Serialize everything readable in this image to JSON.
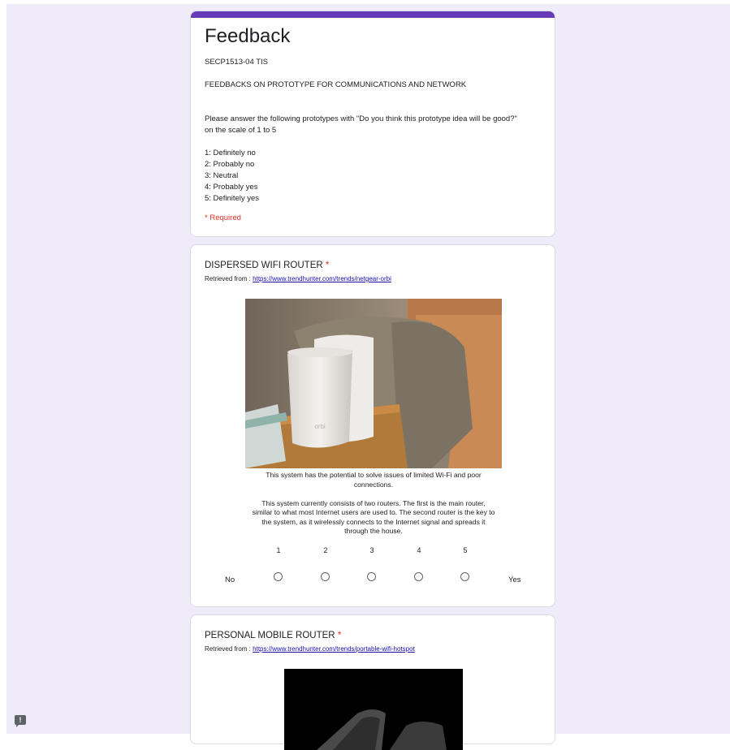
{
  "form": {
    "title": "Feedback",
    "course": "SECP1513-04 TIS",
    "subtitle": "FEEDBACKS ON PROTOTYPE FOR COMMUNICATIONS AND NETWORK",
    "instruction_line1": "Please answer the following prototypes with \"Do you think this prototype idea will be good?\"",
    "instruction_line2": "on the scale of 1 to 5",
    "scale_legend": [
      "1: Definitely no",
      "2: Probably no",
      "3: Neutral",
      "4: Probably yes",
      "5: Definitely yes"
    ],
    "required_note": "* Required",
    "accent_color": "#673ab7",
    "background_color": "#f0ebf8"
  },
  "questions": [
    {
      "title": "DISPERSED WIFI ROUTER",
      "star": "*",
      "retrieved_prefix": "Retrieved from : ",
      "retrieved_link": "https://www.trendhunter.com/trends/netgear-orbi",
      "caption_lines": [
        "This system has the potential to solve issues of limited Wi-Fi and poor",
        "connections.",
        "",
        "This system currently consists of two routers. The first is the main router,",
        "similar to what most Internet users are used to. The second router is the key to",
        "the system, as it wirelessly connects to the Internet signal and spreads it",
        "through the house."
      ],
      "scale": [
        "1",
        "2",
        "3",
        "4",
        "5"
      ],
      "low_label": "No",
      "high_label": "Yes",
      "photo_brand": "orbi"
    },
    {
      "title": "PERSONAL MOBILE ROUTER",
      "star": "*",
      "retrieved_prefix": "Retrieved from : ",
      "retrieved_link": "https://www.trendhunter.com/trends/portable-wifi-hotspot"
    }
  ],
  "feedback_icon": "report-feedback-icon",
  "feedback_icon_glyph": "!"
}
